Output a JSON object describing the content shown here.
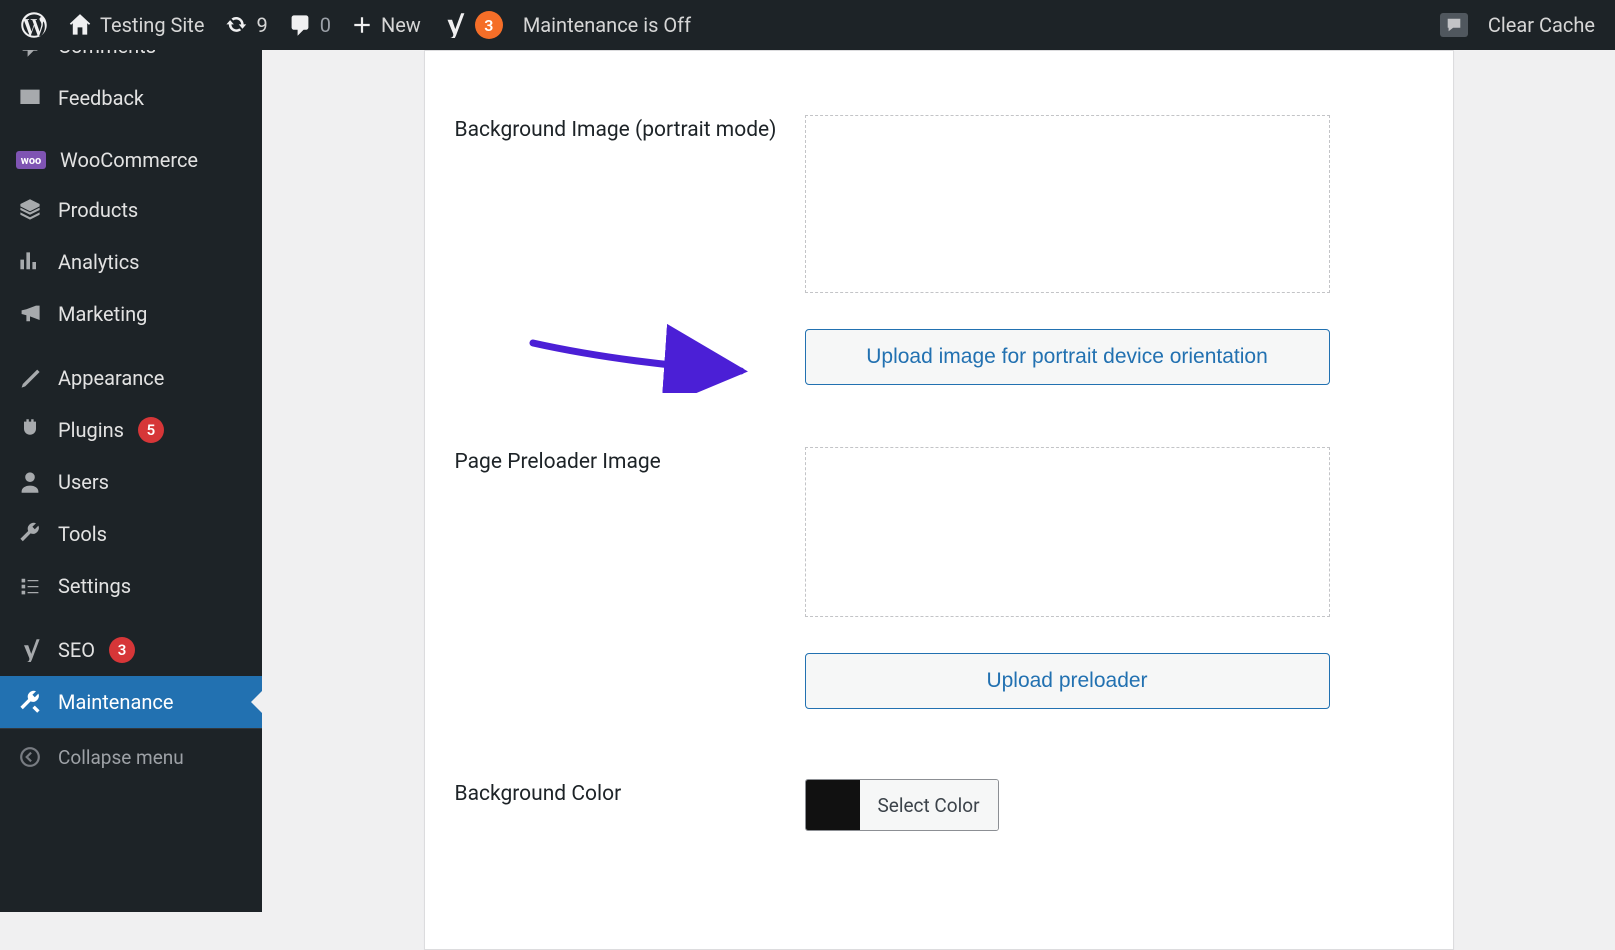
{
  "adminbar": {
    "site_title": "Testing Site",
    "updates_count": "9",
    "comments_count": "0",
    "new_label": "New",
    "yoast_count": "3",
    "maintenance_status": "Maintenance is Off",
    "clear_cache": "Clear Cache"
  },
  "sidebar": {
    "items": [
      {
        "label": "Comments",
        "badge": ""
      },
      {
        "label": "Feedback",
        "badge": ""
      },
      {
        "label": "WooCommerce",
        "badge": ""
      },
      {
        "label": "Products",
        "badge": ""
      },
      {
        "label": "Analytics",
        "badge": ""
      },
      {
        "label": "Marketing",
        "badge": ""
      },
      {
        "label": "Appearance",
        "badge": ""
      },
      {
        "label": "Plugins",
        "badge": "5"
      },
      {
        "label": "Users",
        "badge": ""
      },
      {
        "label": "Tools",
        "badge": ""
      },
      {
        "label": "Settings",
        "badge": ""
      },
      {
        "label": "SEO",
        "badge": "3"
      },
      {
        "label": "Maintenance",
        "badge": ""
      }
    ],
    "collapse_label": "Collapse menu"
  },
  "form": {
    "bg_portrait_label": "Background Image (portrait mode)",
    "upload_portrait_btn": "Upload image for portrait device orientation",
    "preloader_label": "Page Preloader Image",
    "upload_preloader_btn": "Upload preloader",
    "bg_color_label": "Background Color",
    "color_select_label": "Select Color",
    "color_value": "#111111"
  }
}
